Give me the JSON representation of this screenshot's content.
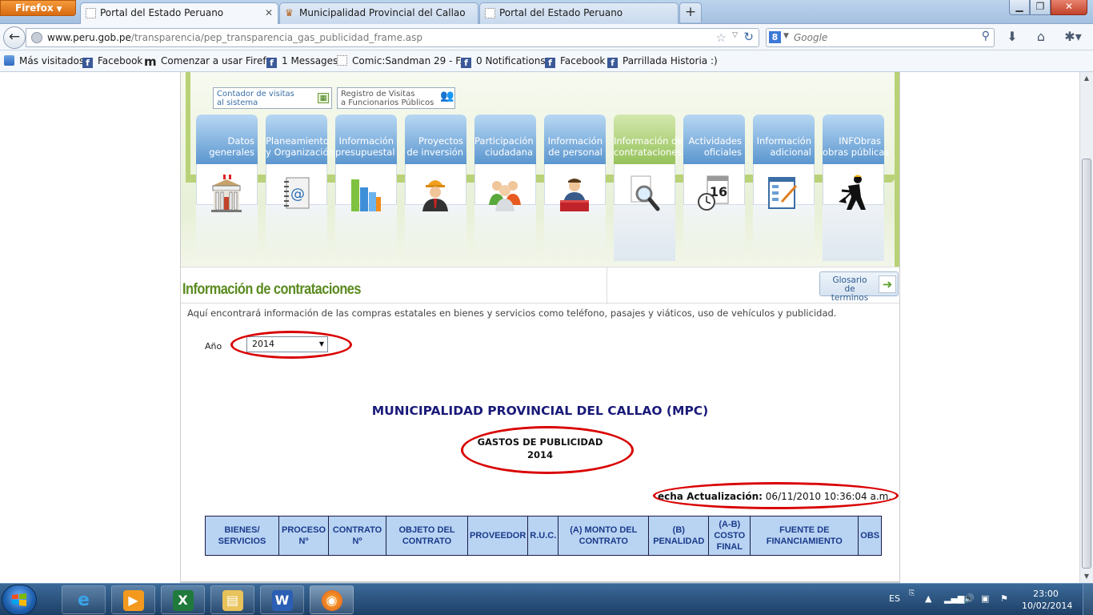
{
  "browser": {
    "menu_button": "Firefox",
    "tabs": [
      {
        "label": "Portal del Estado Peruano",
        "active": true
      },
      {
        "label": "Municipalidad Provincial del Callao",
        "active": false
      },
      {
        "label": "Portal del Estado Peruano",
        "active": false
      }
    ],
    "url_domain": "www.peru.gob.pe",
    "url_path": "/transparencia/pep_transparencia_gas_publicidad_frame.asp",
    "search_placeholder": "Google",
    "bookmarks": [
      {
        "label": "Más visitados",
        "icon": "most-visited-icon"
      },
      {
        "label": "Facebook",
        "icon": "facebook-icon"
      },
      {
        "label": "Comenzar a usar Firefox",
        "icon": "mozilla-icon"
      },
      {
        "label": "1 Messages",
        "icon": "facebook-icon"
      },
      {
        "label": "Comic:Sandman 29 - F...",
        "icon": "page-icon"
      },
      {
        "label": "0 Notifications",
        "icon": "facebook-icon"
      },
      {
        "label": "Facebook",
        "icon": "facebook-icon"
      },
      {
        "label": "Parrillada Historia :)",
        "icon": "facebook-icon"
      }
    ]
  },
  "site": {
    "top_links": {
      "visitas": [
        "Contador de visitas",
        "al sistema"
      ],
      "registro": [
        "Registro de Visitas",
        "a Funcionarios Públicos"
      ]
    },
    "menu": [
      {
        "line1": "Datos",
        "line2": "generales",
        "icon": "building-icon",
        "selected": false
      },
      {
        "line1": "Planeamiento",
        "line2": "y Organización",
        "icon": "address-book-icon",
        "selected": false
      },
      {
        "line1": "Información",
        "line2": "presupuestal",
        "icon": "bar-chart-icon",
        "selected": false
      },
      {
        "line1": "Proyectos",
        "line2": "de inversión",
        "icon": "engineer-icon",
        "selected": false
      },
      {
        "line1": "Participación",
        "line2": "ciudadana",
        "icon": "people-icon",
        "selected": false
      },
      {
        "line1": "Información",
        "line2": "de personal",
        "icon": "employee-icon",
        "selected": false
      },
      {
        "line1": "Información de",
        "line2": "contrataciones",
        "icon": "magnifier-icon",
        "selected": true
      },
      {
        "line1": "Actividades",
        "line2": "oficiales",
        "icon": "calendar-clock-icon",
        "selected": false
      },
      {
        "line1": "Información",
        "line2": "adicional",
        "icon": "form-edit-icon",
        "selected": false
      },
      {
        "line1": "INFObras",
        "line2": "obras públicas",
        "icon": "worker-icon",
        "selected": false
      }
    ],
    "calendar_day": "16",
    "section_title": "Información de contrataciones",
    "glosario": [
      "Glosario",
      "de terminos"
    ],
    "intro": "Aquí encontrará información de las compras estatales en bienes y servicios como teléfono, pasajes y viáticos, uso de vehículos y publicidad.",
    "year_label": "Año",
    "year_value": "2014",
    "entity": "MUNICIPALIDAD PROVINCIAL DEL CALLAO (MPC)",
    "report_title": "GASTOS DE PUBLICIDAD",
    "report_year": "2014",
    "fecha_label": "echa Actualización:",
    "fecha_value": "06/11/2010 10:36:04 a.m.",
    "table_headers": [
      [
        "BIENES/",
        "SERVICIOS"
      ],
      [
        "PROCESO",
        "Nº"
      ],
      [
        "CONTRATO",
        "Nº"
      ],
      [
        "OBJETO DEL",
        "CONTRATO"
      ],
      [
        "PROVEEDOR"
      ],
      [
        "R.U.C."
      ],
      [
        "(A) MONTO DEL",
        "CONTRATO"
      ],
      [
        "(B)",
        "PENALIDAD"
      ],
      [
        "(A-B)",
        "COSTO",
        "FINAL"
      ],
      [
        "FUENTE DE",
        "FINANCIAMIENTO"
      ],
      [
        "OBS"
      ]
    ],
    "colors": {
      "accent_green": "#5a8a1f",
      "tab_blue": "#5b96cf",
      "highlight_red": "#d90000",
      "header_bg": "#b9d4f3"
    }
  },
  "taskbar": {
    "apps": [
      "internet-explorer-icon",
      "media-player-icon",
      "excel-icon",
      "explorer-icon",
      "word-icon",
      "firefox-icon"
    ],
    "language": "ES",
    "time": "23:00",
    "date": "10/02/2014"
  }
}
